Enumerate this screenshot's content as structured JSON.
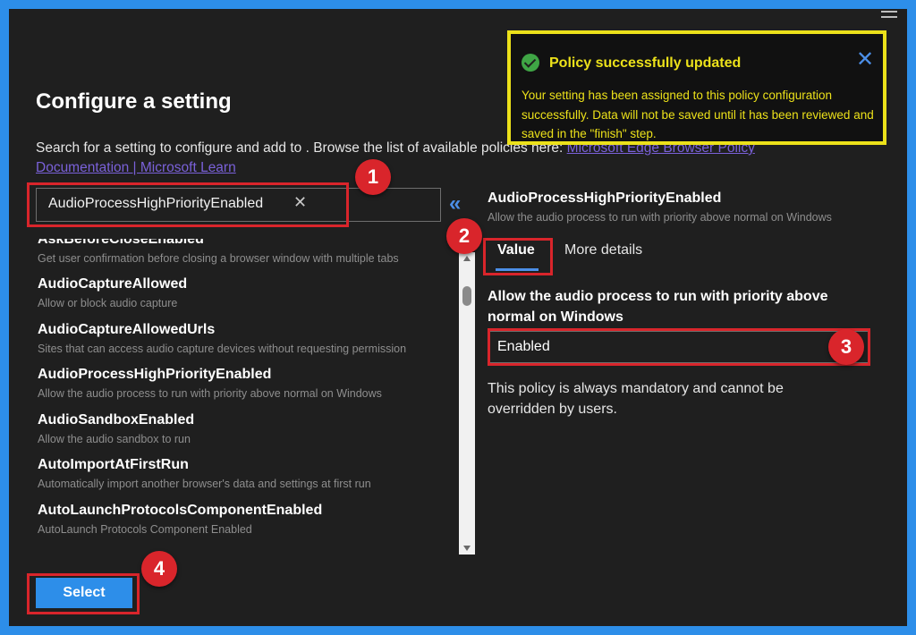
{
  "page": {
    "title": "Configure a setting",
    "intro_text": "Search for a setting to configure and add to . Browse the list of available policies here: ",
    "intro_link": "Microsoft Edge Browser Policy Documentation | Microsoft Learn"
  },
  "search": {
    "value": "AudioProcessHighPriorityEnabled",
    "clear_glyph": "✕"
  },
  "collapse_glyph": "«",
  "settings_list": {
    "items": [
      {
        "name": "AskBeforeCloseEnabled",
        "description": "Get user confirmation before closing a browser window with multiple tabs"
      },
      {
        "name": "AudioCaptureAllowed",
        "description": "Allow or block audio capture"
      },
      {
        "name": "AudioCaptureAllowedUrls",
        "description": "Sites that can access audio capture devices without requesting permission"
      },
      {
        "name": "AudioProcessHighPriorityEnabled",
        "description": "Allow the audio process to run with priority above normal on Windows"
      },
      {
        "name": "AudioSandboxEnabled",
        "description": "Allow the audio sandbox to run"
      },
      {
        "name": "AutoImportAtFirstRun",
        "description": "Automatically import another browser's data and settings at first run"
      },
      {
        "name": "AutoLaunchProtocolsComponentEnabled",
        "description": "AutoLaunch Protocols Component Enabled"
      }
    ]
  },
  "detail": {
    "title": "AudioProcessHighPriorityEnabled",
    "description": "Allow the audio process to run with priority above normal on Windows",
    "tabs": [
      {
        "label": "Value",
        "active": true
      },
      {
        "label": "More details",
        "active": false
      }
    ],
    "field_label": "Allow the audio process to run with priority above normal on Windows",
    "dropdown_value": "Enabled",
    "note": "This policy is always mandatory and cannot be overridden by users."
  },
  "actions": {
    "select_label": "Select"
  },
  "toast": {
    "title": "Policy successfully updated",
    "body": "Your setting has been assigned to this policy configuration successfully. Data will not be saved until it has been reviewed and saved in the \"finish\" step.",
    "close_glyph": "✕",
    "border_color": "#ece11a"
  },
  "callouts": [
    "1",
    "2",
    "3",
    "4"
  ],
  "colors": {
    "accent": "#2d8ee9",
    "highlight": "#d9252b",
    "background": "#1f1f1f"
  }
}
